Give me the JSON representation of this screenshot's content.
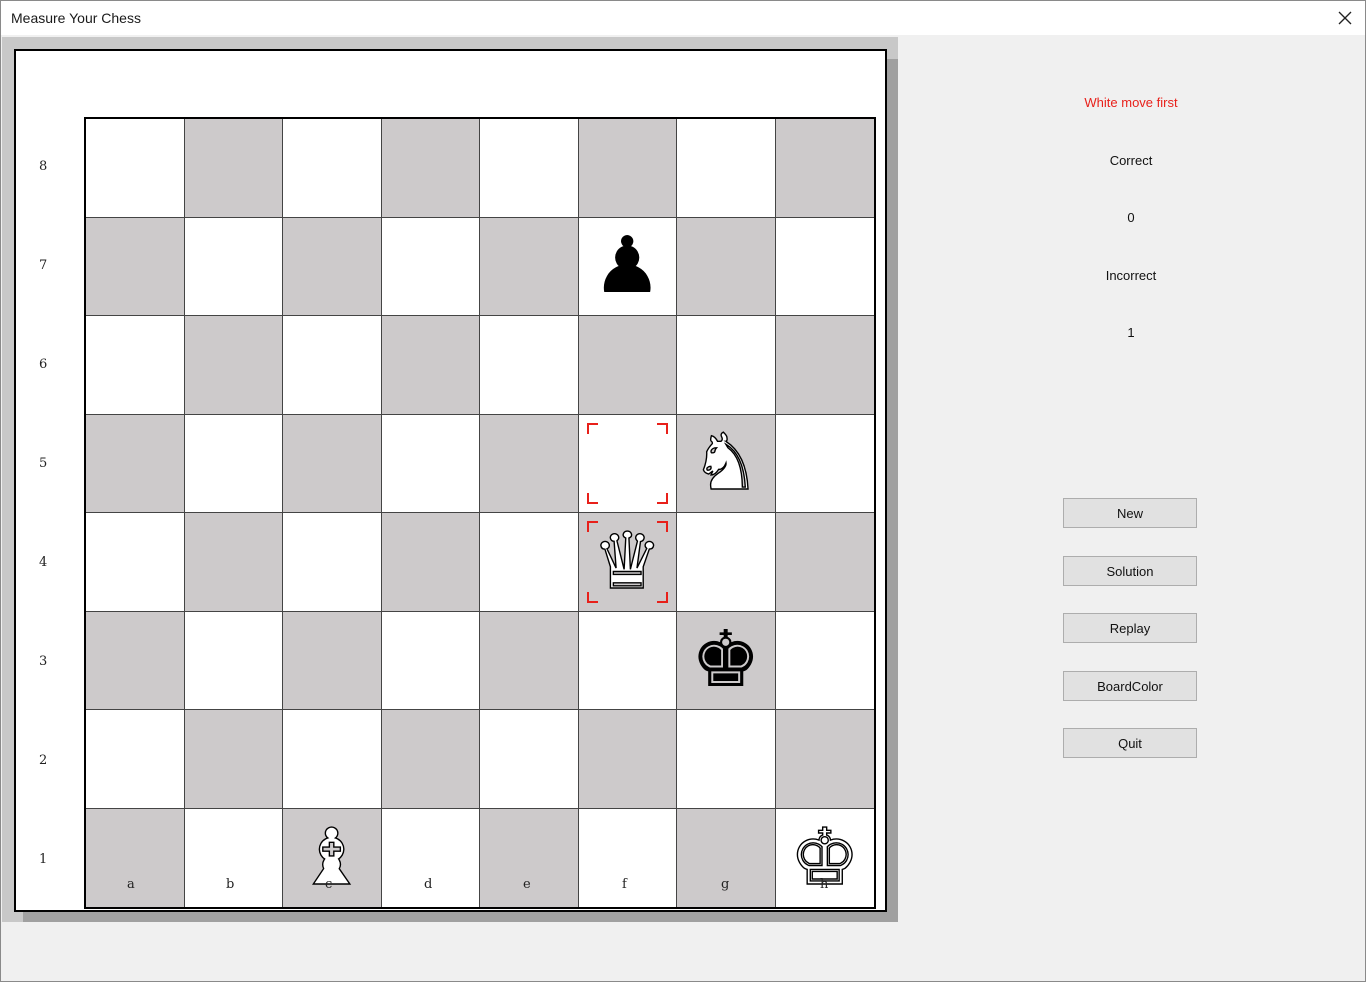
{
  "window": {
    "title": "Measure Your Chess"
  },
  "board": {
    "ranks": [
      "8",
      "7",
      "6",
      "5",
      "4",
      "3",
      "2",
      "1"
    ],
    "files": [
      "a",
      "b",
      "c",
      "d",
      "e",
      "f",
      "g",
      "h"
    ],
    "colors": {
      "light": "#ffffff",
      "dark": "#cdcacb",
      "highlight": "#e8201a"
    },
    "pieces": [
      {
        "square": "f7",
        "type": "pawn",
        "color": "black",
        "glyph": "♟"
      },
      {
        "square": "g5",
        "type": "knight",
        "color": "white",
        "glyph": "♞"
      },
      {
        "square": "f4",
        "type": "queen",
        "color": "white",
        "glyph": "♛"
      },
      {
        "square": "g3",
        "type": "king",
        "color": "black",
        "glyph": "♚"
      },
      {
        "square": "c1",
        "type": "bishop",
        "color": "white",
        "glyph": "♝"
      },
      {
        "square": "h1",
        "type": "king",
        "color": "white",
        "glyph": "♚"
      }
    ],
    "highlighted_squares": [
      "f5",
      "f4"
    ]
  },
  "side": {
    "status": "White move first",
    "correct_label": "Correct",
    "correct_value": "0",
    "incorrect_label": "Incorrect",
    "incorrect_value": "1",
    "buttons": {
      "new": "New",
      "solution": "Solution",
      "replay": "Replay",
      "boardcolor": "BoardColor",
      "quit": "Quit"
    }
  }
}
